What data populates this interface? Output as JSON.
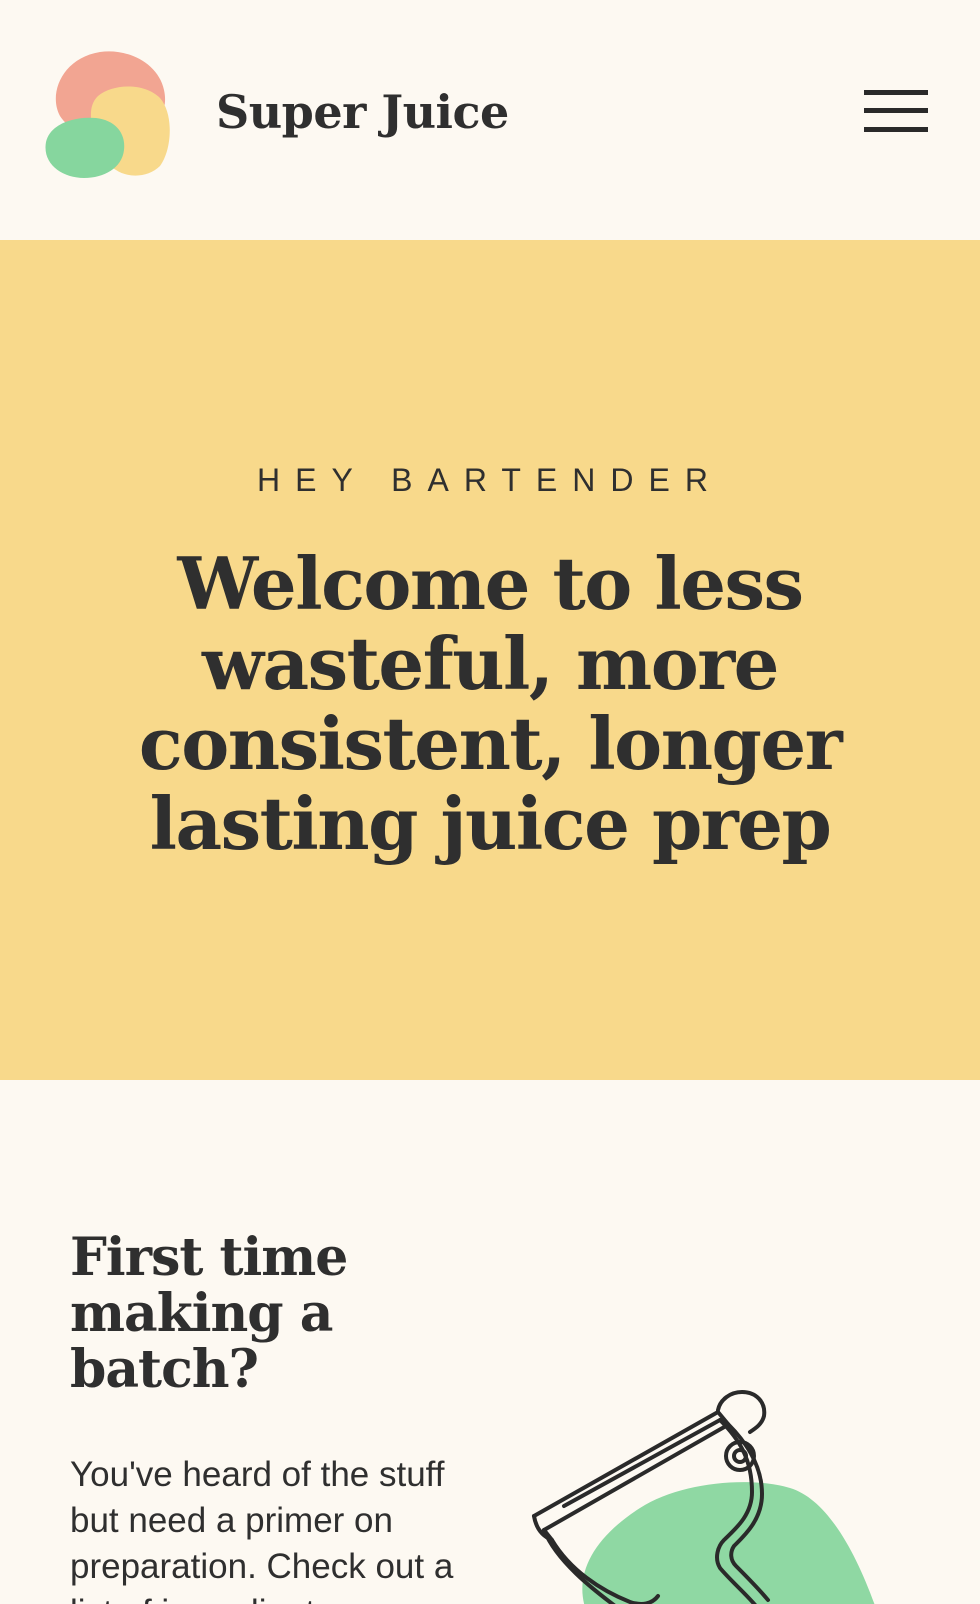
{
  "header": {
    "brand": "Super Juice",
    "logo_icon": "fruit-blobs-logo",
    "menu_icon": "hamburger-menu-icon"
  },
  "hero": {
    "eyebrow": "HEY BARTENDER",
    "title": "Welcome to less wasteful, more consistent, longer lasting juice prep"
  },
  "section": {
    "title": "First time making a batch?",
    "body": "You've heard of the stuff but need a primer on preparation. Check out a list of ingredients",
    "illustration_icon": "peeler-illustration"
  },
  "colors": {
    "background": "#fdf9f2",
    "hero_background": "#f8d98b",
    "text": "#2f2f2f",
    "logo_red": "#f2a592",
    "logo_yellow": "#f8d98b",
    "logo_green": "#86d69e",
    "illustration_green": "#8fd8a3"
  }
}
